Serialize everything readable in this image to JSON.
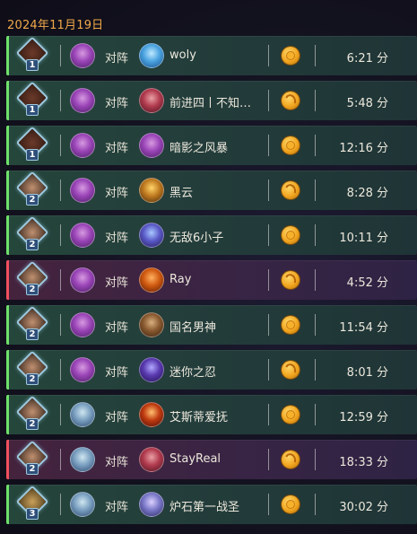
{
  "header": {
    "date": "2024年11月19日"
  },
  "vs_label": "对阵",
  "matches": [
    {
      "result": "win",
      "rank": "1",
      "opponent": "woly",
      "coin": "first",
      "duration": "6:21 分"
    },
    {
      "result": "win",
      "rank": "1",
      "opponent": "前进四丨不知…",
      "coin": "second",
      "duration": "5:48 分"
    },
    {
      "result": "win",
      "rank": "1",
      "opponent": "暗影之风暴",
      "coin": "first",
      "duration": "12:16 分"
    },
    {
      "result": "win",
      "rank": "2",
      "opponent": "黑云",
      "coin": "second",
      "duration": "8:28 分"
    },
    {
      "result": "win",
      "rank": "2",
      "opponent": "无敌6小子",
      "coin": "first",
      "duration": "10:11 分"
    },
    {
      "result": "loss",
      "rank": "2",
      "opponent": "Ray",
      "coin": "second",
      "duration": "4:52 分"
    },
    {
      "result": "win",
      "rank": "2",
      "opponent": "国名男神",
      "coin": "first",
      "duration": "11:54 分"
    },
    {
      "result": "win",
      "rank": "2",
      "opponent": "迷你之忍",
      "coin": "second",
      "duration": "8:01 分"
    },
    {
      "result": "win",
      "rank": "2",
      "opponent": "艾斯蒂爱抚",
      "coin": "first",
      "duration": "12:59 分"
    },
    {
      "result": "loss",
      "rank": "2",
      "opponent": "StayReal",
      "coin": "second",
      "duration": "18:33 分"
    },
    {
      "result": "win",
      "rank": "3",
      "opponent": "炉石第一战圣",
      "coin": "first",
      "duration": "30:02 分"
    }
  ],
  "colors": {
    "win": "#6fe06a",
    "loss": "#f0505e",
    "date": "#f0a94a"
  }
}
